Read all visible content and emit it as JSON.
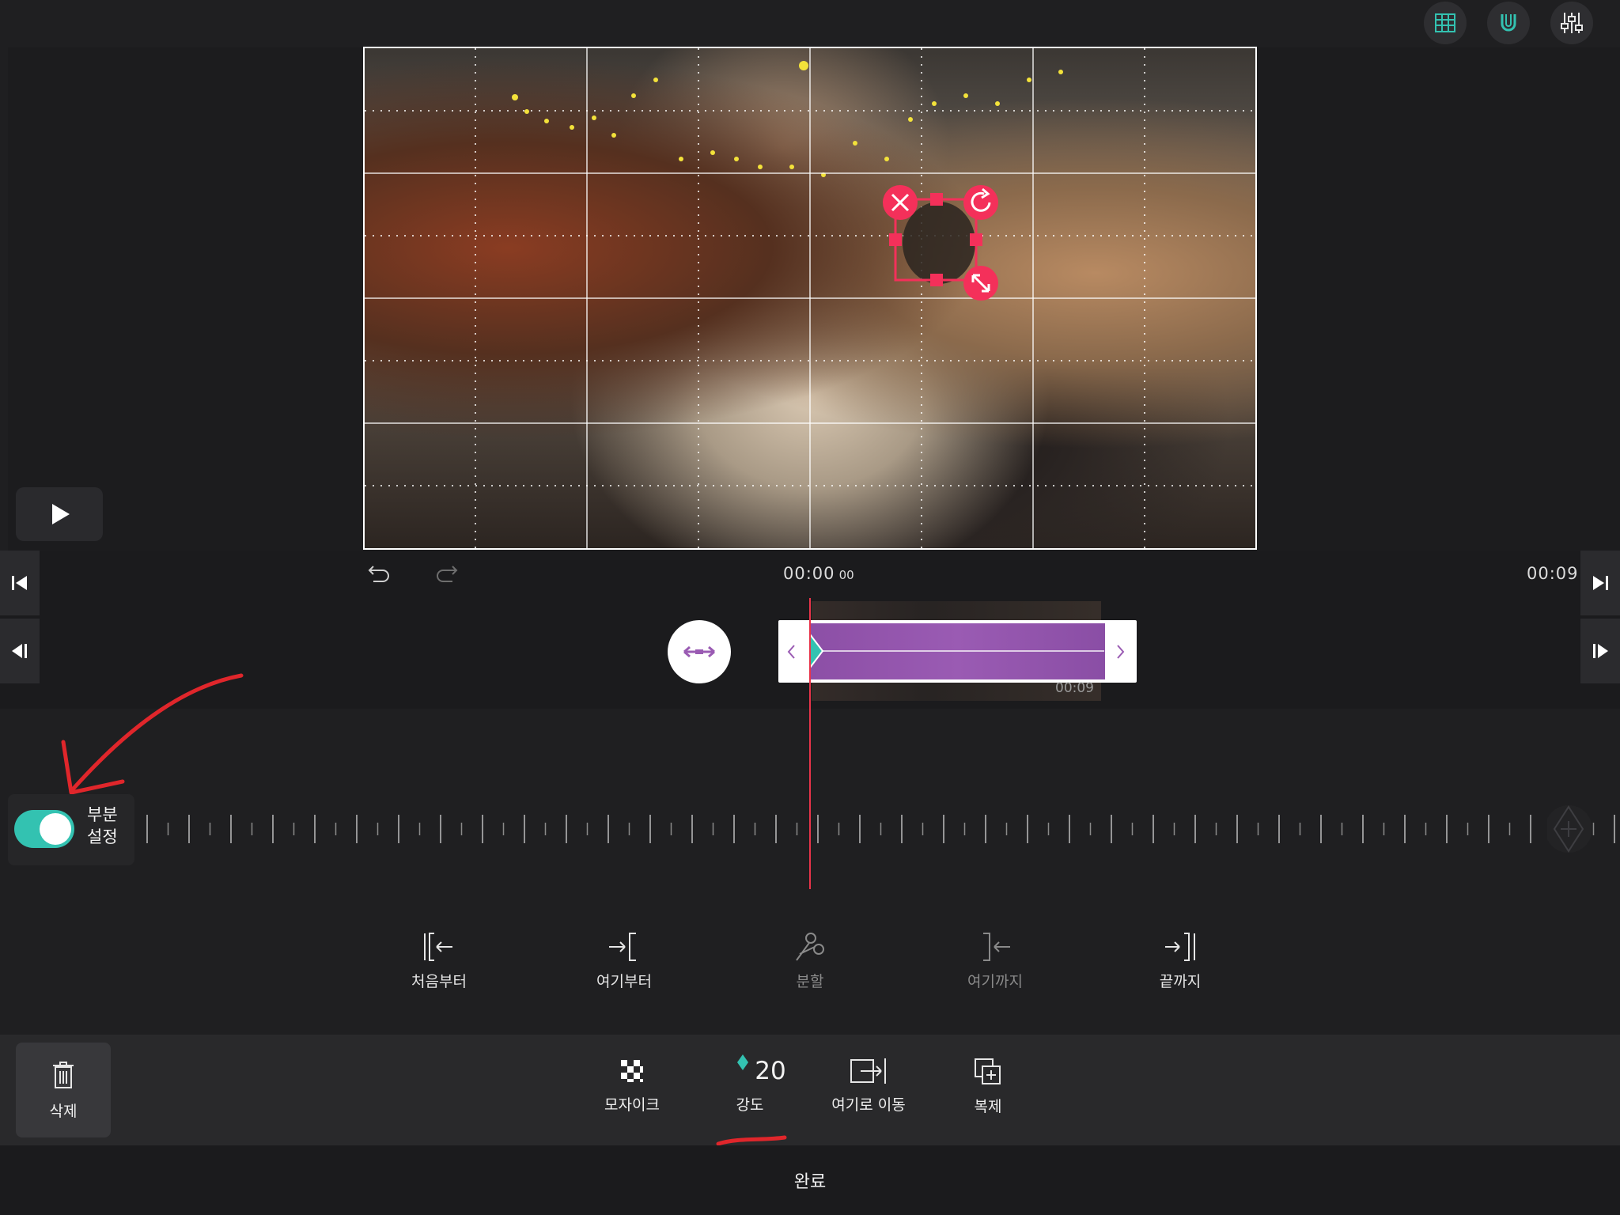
{
  "top_icons": [
    "grid-icon",
    "magnet-icon",
    "sliders-icon"
  ],
  "player": {
    "current_time": "00:00",
    "current_frame": "00",
    "total_time": "00:09"
  },
  "clip": {
    "duration": "00:09"
  },
  "partial_toggle": {
    "label_line1": "부분",
    "label_line2": "설정",
    "on": true
  },
  "actions": {
    "from_start": "처음부터",
    "from_here": "여기부터",
    "split": "분할",
    "to_here": "여기까지",
    "to_end": "끝까지"
  },
  "bottom_tools": {
    "delete": "삭제",
    "mosaic": "모자이크",
    "strength_value": "20",
    "strength": "강도",
    "move_here": "여기로 이동",
    "duplicate": "복제"
  },
  "done": "완료",
  "colors": {
    "accent": "#33c2b1",
    "playhead": "#e8344a",
    "clip": "#9a5bb3",
    "handle": "#f4305a"
  }
}
